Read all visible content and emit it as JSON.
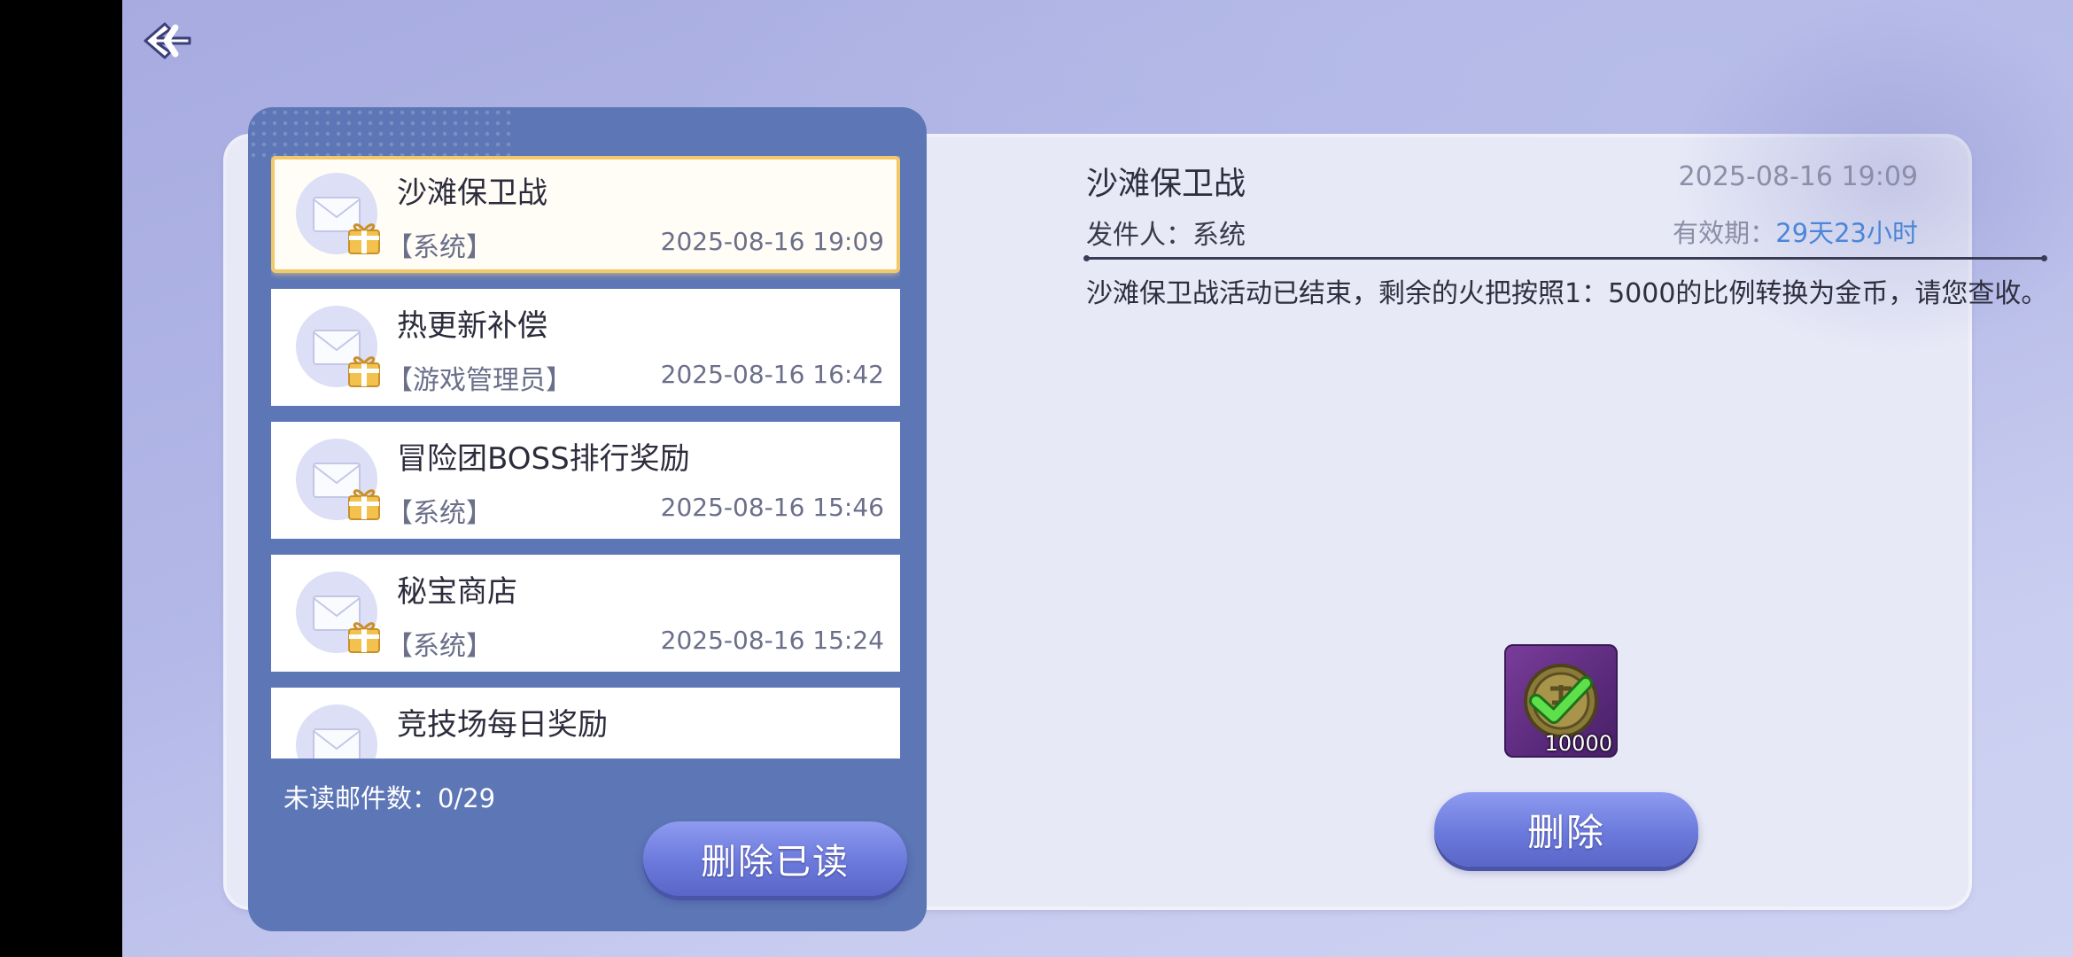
{
  "mailbox": {
    "items": [
      {
        "title": "沙滩保卫战",
        "sender": "【系统】",
        "date": "2025-08-16 19:09"
      },
      {
        "title": "热更新补偿",
        "sender": "【游戏管理员】",
        "date": "2025-08-16 16:42"
      },
      {
        "title": "冒险团BOSS排行奖励",
        "sender": "【系统】",
        "date": "2025-08-16 15:46"
      },
      {
        "title": "秘宝商店",
        "sender": "【系统】",
        "date": "2025-08-16 15:24"
      },
      {
        "title": "竞技场每日奖励",
        "sender": "",
        "date": ""
      }
    ],
    "unread_label": "未读邮件数：0/29",
    "delete_read_label": "删除已读"
  },
  "detail": {
    "title": "沙滩保卫战",
    "date": "2025-08-16 19:09",
    "sender": "发件人：系统",
    "expire_label": "有效期：",
    "expire_value": "29天23小时",
    "body": "沙滩保卫战活动已结束，剩余的火把按照1：5000的比例转换为金币，请您查收。",
    "reward_count": "10000",
    "delete_label": "删除"
  },
  "colors": {
    "panel_blue": "#5d76b6",
    "selected_border": "#f2c96a",
    "expire_highlight": "#4b86d8",
    "button": "#6b79dc"
  },
  "icons": [
    "back-arrow-icon",
    "envelope-icon",
    "gift-icon",
    "gold-coin-icon",
    "checkmark-icon"
  ]
}
